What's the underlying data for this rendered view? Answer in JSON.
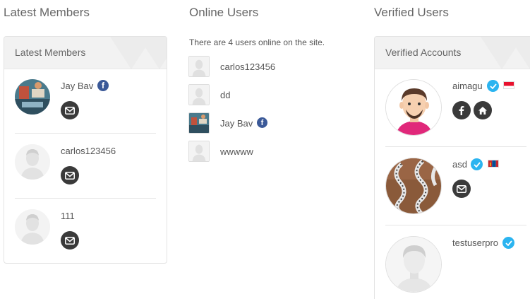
{
  "columns": {
    "latest_title": "Latest Members",
    "online_title": "Online Users",
    "verified_title": "Verified Users"
  },
  "latest_panel": {
    "header": "Latest Members",
    "members": [
      {
        "name": "Jay Bav",
        "social": "facebook",
        "action_icon": "mail-icon"
      },
      {
        "name": "carlos123456",
        "action_icon": "mail-icon"
      },
      {
        "name": "111",
        "action_icon": "mail-icon"
      }
    ]
  },
  "online": {
    "info": "There are 4 users online on the site.",
    "users": [
      {
        "name": "carlos123456"
      },
      {
        "name": "dd"
      },
      {
        "name": "Jay Bav",
        "social": "facebook"
      },
      {
        "name": "wwwww"
      }
    ]
  },
  "verified_panel": {
    "header": "Verified Accounts",
    "accounts": [
      {
        "name": "aimagu",
        "verified": true,
        "flag": "indonesia",
        "actions": [
          "facebook-icon",
          "home-icon"
        ]
      },
      {
        "name": "asd",
        "verified": true,
        "flag": "mongolia",
        "actions": [
          "mail-icon"
        ]
      },
      {
        "name": "testuserpro",
        "verified": true
      }
    ]
  },
  "icons": {
    "facebook_glyph": "f"
  },
  "colors": {
    "facebook": "#3b5998",
    "verified": "#2bb4f0",
    "action_button": "#3a3a3a",
    "panel_header": "#f2f2f2"
  }
}
